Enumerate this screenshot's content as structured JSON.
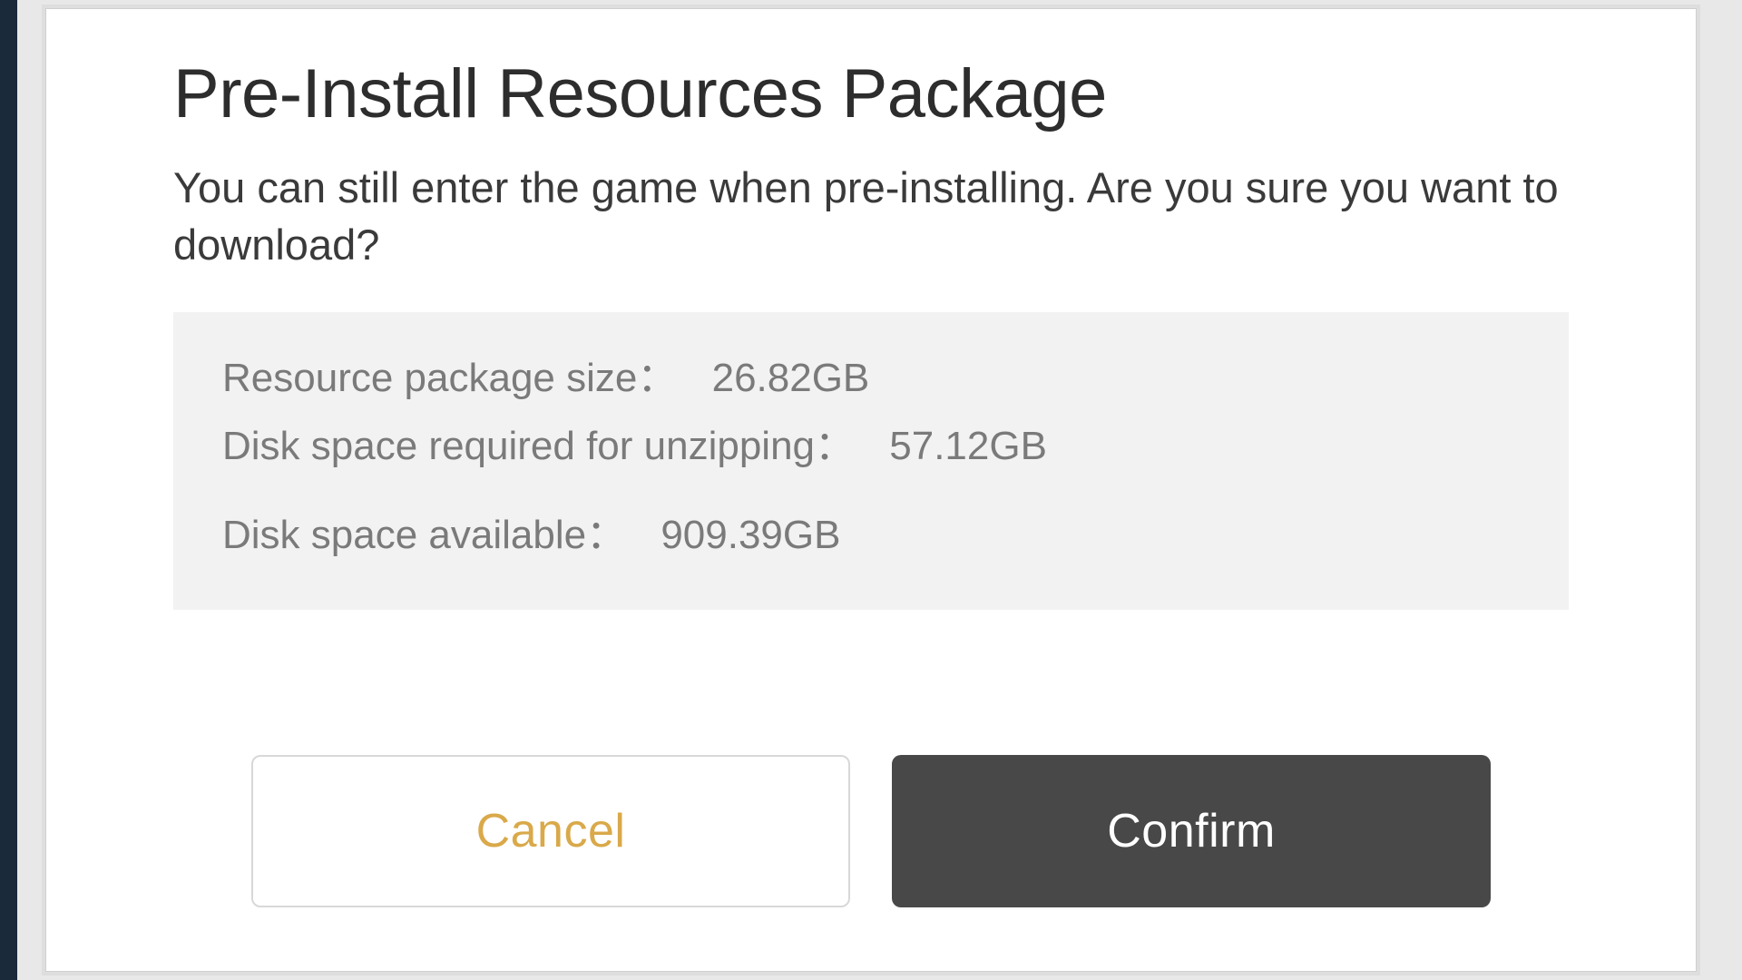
{
  "dialog": {
    "title": "Pre-Install Resources Package",
    "message": "You can still enter the game when pre-installing. Are you sure you want to download?",
    "info": {
      "package_size_label": "Resource package size：",
      "package_size_value": "26.82GB",
      "unzip_space_label": "Disk space required for unzipping：",
      "unzip_space_value": "57.12GB",
      "disk_available_label": "Disk space available：",
      "disk_available_value": "909.39GB"
    },
    "buttons": {
      "cancel_label": "Cancel",
      "confirm_label": "Confirm"
    }
  },
  "colors": {
    "accent_gold": "#d9a94a",
    "confirm_bg": "#484848"
  }
}
